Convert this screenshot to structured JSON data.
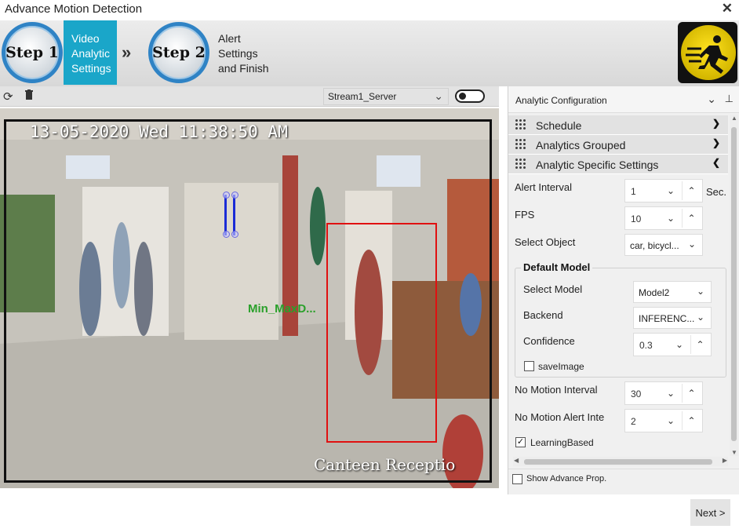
{
  "window": {
    "title": "Advance Motion Detection",
    "close_glyph": "✕"
  },
  "wizard": {
    "step1": {
      "badge": "Step 1",
      "label_lines": [
        "Video",
        "Analytic",
        "Settings"
      ]
    },
    "separator": "»",
    "step2": {
      "badge": "Step 2",
      "label_lines": [
        "Alert",
        "Settings",
        "and Finish"
      ]
    },
    "accent_color": "#1aa6c9",
    "emblem_icon": "running-man-icon"
  },
  "video_toolbar": {
    "refresh_icon": "refresh-icon",
    "delete_icon": "trash-icon",
    "stream_selected": "Stream1_Server",
    "toggle_on": false
  },
  "video": {
    "timestamp": "13-05-2020 Wed 11:38:50 AM",
    "location": "Canteen Receptio",
    "region_label": "Min_MaxD...",
    "roi_color": "#e01010",
    "line_color": "#1a2bd6"
  },
  "panel": {
    "title": "Analytic Configuration",
    "sections": [
      {
        "label": "Schedule",
        "expanded": false
      },
      {
        "label": "Analytics Grouped",
        "expanded": false
      },
      {
        "label": "Analytic Specific Settings",
        "expanded": true
      }
    ],
    "alert_interval": {
      "label": "Alert Interval",
      "value": "1",
      "unit": "Sec."
    },
    "fps": {
      "label": "FPS",
      "value": "10"
    },
    "select_object": {
      "label": "Select Object",
      "value": "car, bicycl..."
    },
    "default_model": {
      "title": "Default Model",
      "select_model": {
        "label": "Select Model",
        "value": "Model2"
      },
      "backend": {
        "label": "Backend",
        "value": "INFERENC..."
      },
      "confidence": {
        "label": "Confidence",
        "value": "0.3"
      },
      "save_image": {
        "label": "saveImage",
        "checked": false
      }
    },
    "no_motion_interval": {
      "label": "No Motion Interval",
      "value": "30"
    },
    "no_motion_alert": {
      "label": "No Motion Alert Inte",
      "value": "2"
    },
    "learning_based": {
      "label": "LearningBased",
      "checked": true
    },
    "show_advance": {
      "label": "Show Advance Prop.",
      "checked": false
    }
  },
  "footer": {
    "next_label": "Next >"
  }
}
